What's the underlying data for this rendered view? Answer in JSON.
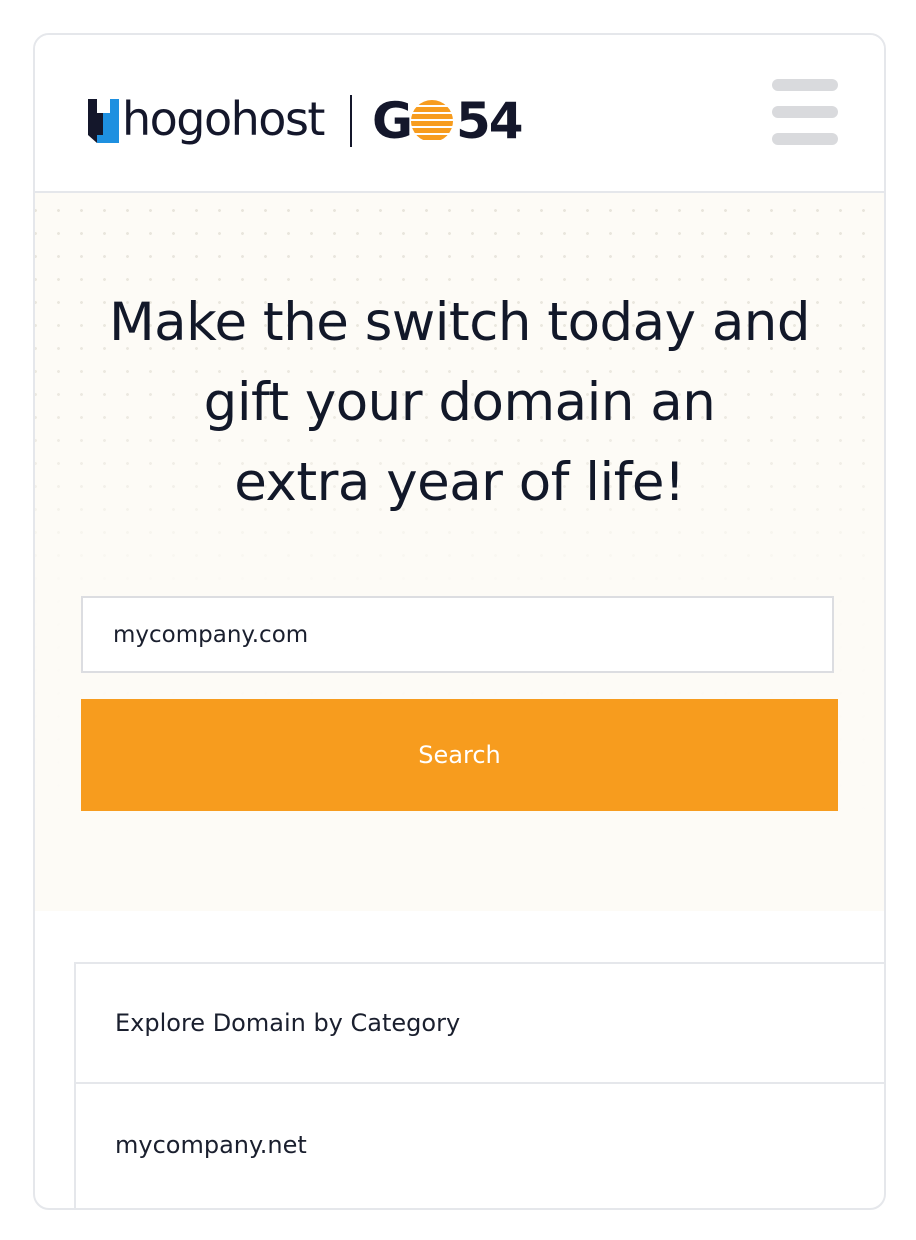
{
  "header": {
    "brand_name": "hogohost",
    "partner_name": "G54",
    "menu_icon": "hamburger-menu-icon"
  },
  "hero": {
    "headline_line1": "Make the switch today and",
    "headline_line2": "gift your domain an",
    "headline_line3": "extra year of life!",
    "search_placeholder": "mycompany.com",
    "search_button_label": "Search"
  },
  "results": {
    "items": [
      {
        "label": "Explore Domain by Category"
      },
      {
        "label": "mycompany.net"
      }
    ]
  },
  "colors": {
    "accent": "#f79c1e",
    "text_dark": "#121829",
    "brand_blue": "#1e90e0",
    "hero_bg": "#fdfbf6"
  }
}
